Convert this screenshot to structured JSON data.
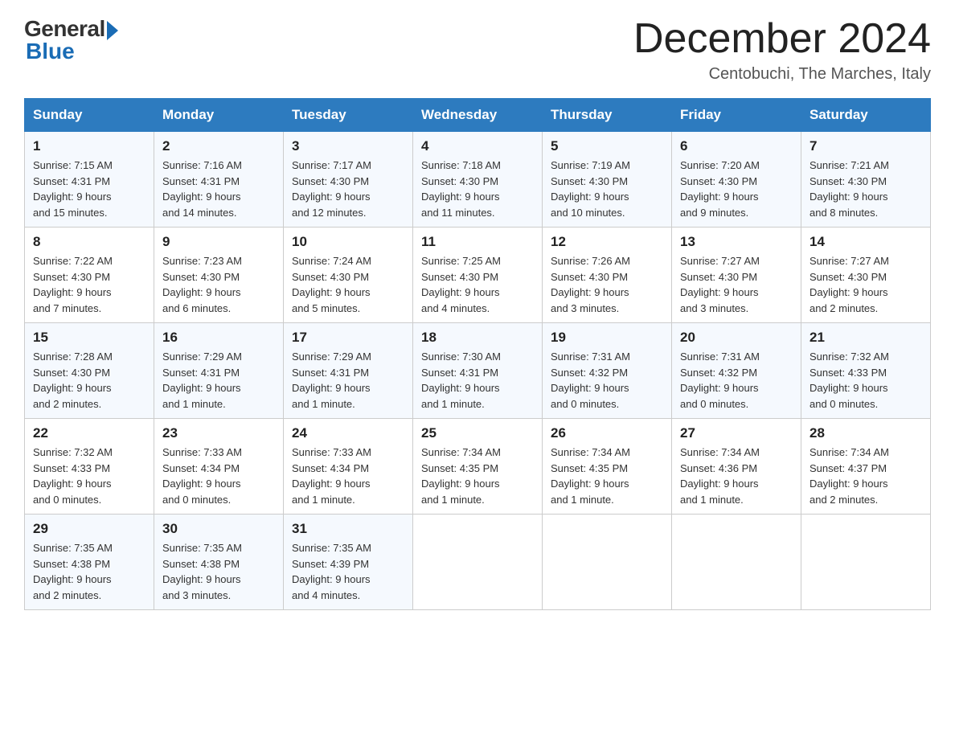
{
  "header": {
    "logo": {
      "general_text": "General",
      "blue_text": "Blue"
    },
    "title": "December 2024",
    "subtitle": "Centobuchi, The Marches, Italy"
  },
  "days_of_week": [
    "Sunday",
    "Monday",
    "Tuesday",
    "Wednesday",
    "Thursday",
    "Friday",
    "Saturday"
  ],
  "weeks": [
    [
      {
        "day": "1",
        "sunrise": "7:15 AM",
        "sunset": "4:31 PM",
        "daylight": "9 hours and 15 minutes."
      },
      {
        "day": "2",
        "sunrise": "7:16 AM",
        "sunset": "4:31 PM",
        "daylight": "9 hours and 14 minutes."
      },
      {
        "day": "3",
        "sunrise": "7:17 AM",
        "sunset": "4:30 PM",
        "daylight": "9 hours and 12 minutes."
      },
      {
        "day": "4",
        "sunrise": "7:18 AM",
        "sunset": "4:30 PM",
        "daylight": "9 hours and 11 minutes."
      },
      {
        "day": "5",
        "sunrise": "7:19 AM",
        "sunset": "4:30 PM",
        "daylight": "9 hours and 10 minutes."
      },
      {
        "day": "6",
        "sunrise": "7:20 AM",
        "sunset": "4:30 PM",
        "daylight": "9 hours and 9 minutes."
      },
      {
        "day": "7",
        "sunrise": "7:21 AM",
        "sunset": "4:30 PM",
        "daylight": "9 hours and 8 minutes."
      }
    ],
    [
      {
        "day": "8",
        "sunrise": "7:22 AM",
        "sunset": "4:30 PM",
        "daylight": "9 hours and 7 minutes."
      },
      {
        "day": "9",
        "sunrise": "7:23 AM",
        "sunset": "4:30 PM",
        "daylight": "9 hours and 6 minutes."
      },
      {
        "day": "10",
        "sunrise": "7:24 AM",
        "sunset": "4:30 PM",
        "daylight": "9 hours and 5 minutes."
      },
      {
        "day": "11",
        "sunrise": "7:25 AM",
        "sunset": "4:30 PM",
        "daylight": "9 hours and 4 minutes."
      },
      {
        "day": "12",
        "sunrise": "7:26 AM",
        "sunset": "4:30 PM",
        "daylight": "9 hours and 3 minutes."
      },
      {
        "day": "13",
        "sunrise": "7:27 AM",
        "sunset": "4:30 PM",
        "daylight": "9 hours and 3 minutes."
      },
      {
        "day": "14",
        "sunrise": "7:27 AM",
        "sunset": "4:30 PM",
        "daylight": "9 hours and 2 minutes."
      }
    ],
    [
      {
        "day": "15",
        "sunrise": "7:28 AM",
        "sunset": "4:30 PM",
        "daylight": "9 hours and 2 minutes."
      },
      {
        "day": "16",
        "sunrise": "7:29 AM",
        "sunset": "4:31 PM",
        "daylight": "9 hours and 1 minute."
      },
      {
        "day": "17",
        "sunrise": "7:29 AM",
        "sunset": "4:31 PM",
        "daylight": "9 hours and 1 minute."
      },
      {
        "day": "18",
        "sunrise": "7:30 AM",
        "sunset": "4:31 PM",
        "daylight": "9 hours and 1 minute."
      },
      {
        "day": "19",
        "sunrise": "7:31 AM",
        "sunset": "4:32 PM",
        "daylight": "9 hours and 0 minutes."
      },
      {
        "day": "20",
        "sunrise": "7:31 AM",
        "sunset": "4:32 PM",
        "daylight": "9 hours and 0 minutes."
      },
      {
        "day": "21",
        "sunrise": "7:32 AM",
        "sunset": "4:33 PM",
        "daylight": "9 hours and 0 minutes."
      }
    ],
    [
      {
        "day": "22",
        "sunrise": "7:32 AM",
        "sunset": "4:33 PM",
        "daylight": "9 hours and 0 minutes."
      },
      {
        "day": "23",
        "sunrise": "7:33 AM",
        "sunset": "4:34 PM",
        "daylight": "9 hours and 0 minutes."
      },
      {
        "day": "24",
        "sunrise": "7:33 AM",
        "sunset": "4:34 PM",
        "daylight": "9 hours and 1 minute."
      },
      {
        "day": "25",
        "sunrise": "7:34 AM",
        "sunset": "4:35 PM",
        "daylight": "9 hours and 1 minute."
      },
      {
        "day": "26",
        "sunrise": "7:34 AM",
        "sunset": "4:35 PM",
        "daylight": "9 hours and 1 minute."
      },
      {
        "day": "27",
        "sunrise": "7:34 AM",
        "sunset": "4:36 PM",
        "daylight": "9 hours and 1 minute."
      },
      {
        "day": "28",
        "sunrise": "7:34 AM",
        "sunset": "4:37 PM",
        "daylight": "9 hours and 2 minutes."
      }
    ],
    [
      {
        "day": "29",
        "sunrise": "7:35 AM",
        "sunset": "4:38 PM",
        "daylight": "9 hours and 2 minutes."
      },
      {
        "day": "30",
        "sunrise": "7:35 AM",
        "sunset": "4:38 PM",
        "daylight": "9 hours and 3 minutes."
      },
      {
        "day": "31",
        "sunrise": "7:35 AM",
        "sunset": "4:39 PM",
        "daylight": "9 hours and 4 minutes."
      },
      null,
      null,
      null,
      null
    ]
  ],
  "labels": {
    "sunrise": "Sunrise:",
    "sunset": "Sunset:",
    "daylight": "Daylight:"
  }
}
